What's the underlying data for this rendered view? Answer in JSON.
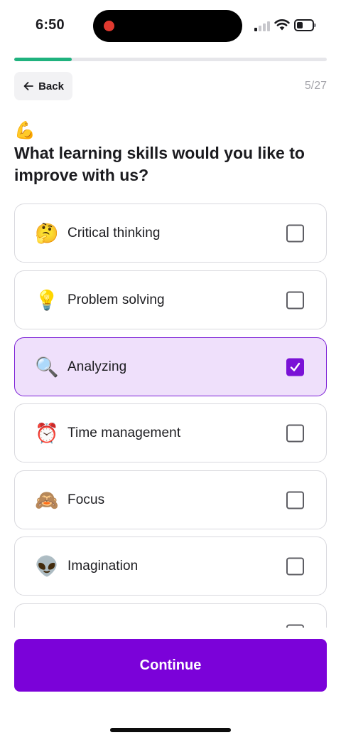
{
  "status_bar": {
    "time": "6:50",
    "recording_color": "#e0392f"
  },
  "progress": {
    "fraction": 0.185,
    "color": "#1fb27e"
  },
  "header": {
    "back_label": "Back",
    "back_icon": "arrow-left-icon",
    "step_counter": "5/27"
  },
  "question": {
    "emoji": "💪",
    "title": "What learning skills would you like to improve with us?"
  },
  "options": [
    {
      "emoji": "🤔",
      "label": "Critical thinking",
      "checked": false
    },
    {
      "emoji": "💡",
      "label": "Problem solving",
      "checked": false
    },
    {
      "emoji": "🔍",
      "label": "Analyzing",
      "checked": true
    },
    {
      "emoji": "⏰",
      "label": "Time management",
      "checked": false
    },
    {
      "emoji": "🙈",
      "label": "Focus",
      "checked": false
    },
    {
      "emoji": "👽",
      "label": "Imagination",
      "checked": false
    }
  ],
  "footer": {
    "continue_label": "Continue",
    "accent_color": "#7b02d9"
  }
}
